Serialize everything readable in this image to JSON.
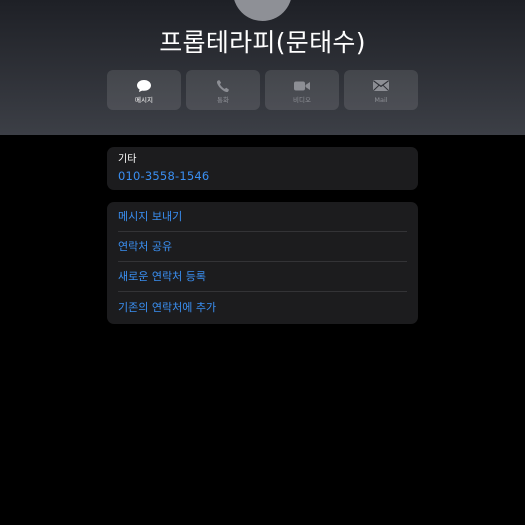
{
  "contact": {
    "name": "프롭테라피(문태수)"
  },
  "actions": [
    {
      "label": "메시지",
      "icon": "message-bubble-icon",
      "enabled": true
    },
    {
      "label": "통화",
      "icon": "phone-icon",
      "enabled": false
    },
    {
      "label": "비디오",
      "icon": "video-camera-icon",
      "enabled": false
    },
    {
      "label": "Mail",
      "icon": "envelope-icon",
      "enabled": false
    }
  ],
  "phone": {
    "label": "기타",
    "number": "010-3558-1546"
  },
  "options": [
    {
      "label": "메시지 보내기"
    },
    {
      "label": "연락처 공유"
    },
    {
      "label": "새로운 연락처 등록"
    },
    {
      "label": "기존의 연락처에 추가"
    }
  ],
  "colors": {
    "accent": "#3a8ff2",
    "card_background": "#1c1c1e",
    "background": "#000000",
    "disabled_text": "#8c8e94"
  }
}
